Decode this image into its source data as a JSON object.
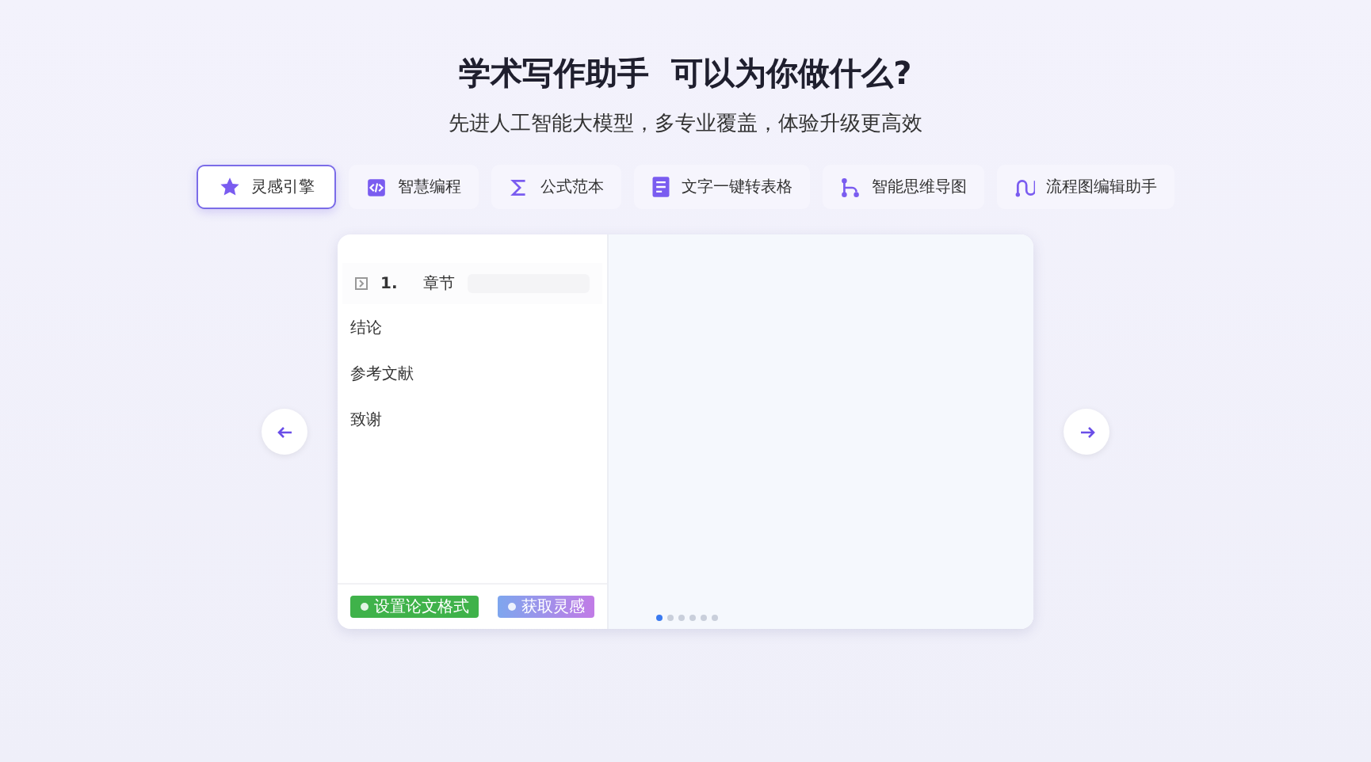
{
  "heading": {
    "title": "学术写作助手  可以为你做什么?",
    "subtitle": "先进人工智能大模型，多专业覆盖，体验升级更高效"
  },
  "tabs": [
    {
      "label": "灵感引擎",
      "kind": "star",
      "selected": true
    },
    {
      "label": "智慧编程",
      "kind": "code",
      "selected": false
    },
    {
      "label": "公式范本",
      "kind": "sigma",
      "selected": false
    },
    {
      "label": "文字一键转表格",
      "kind": "doc",
      "selected": false
    },
    {
      "label": "智能思维导图",
      "kind": "branch",
      "selected": false
    },
    {
      "label": "流程图编辑助手",
      "kind": "flow",
      "selected": false
    }
  ],
  "preview": {
    "outline": [
      {
        "kind": "chapter",
        "number": "1.",
        "label": "章节"
      },
      {
        "kind": "section",
        "label": "结论"
      },
      {
        "kind": "section",
        "label": "参考文献"
      },
      {
        "kind": "section",
        "label": "致谢"
      }
    ],
    "buttons": [
      {
        "kind": "format",
        "label": "设置论文格式"
      },
      {
        "kind": "inspire",
        "label": "获取灵感"
      }
    ]
  },
  "slides": [
    {
      "selected": true
    },
    {
      "selected": false
    },
    {
      "selected": false
    },
    {
      "selected": false
    },
    {
      "selected": false
    },
    {
      "selected": false
    }
  ]
}
